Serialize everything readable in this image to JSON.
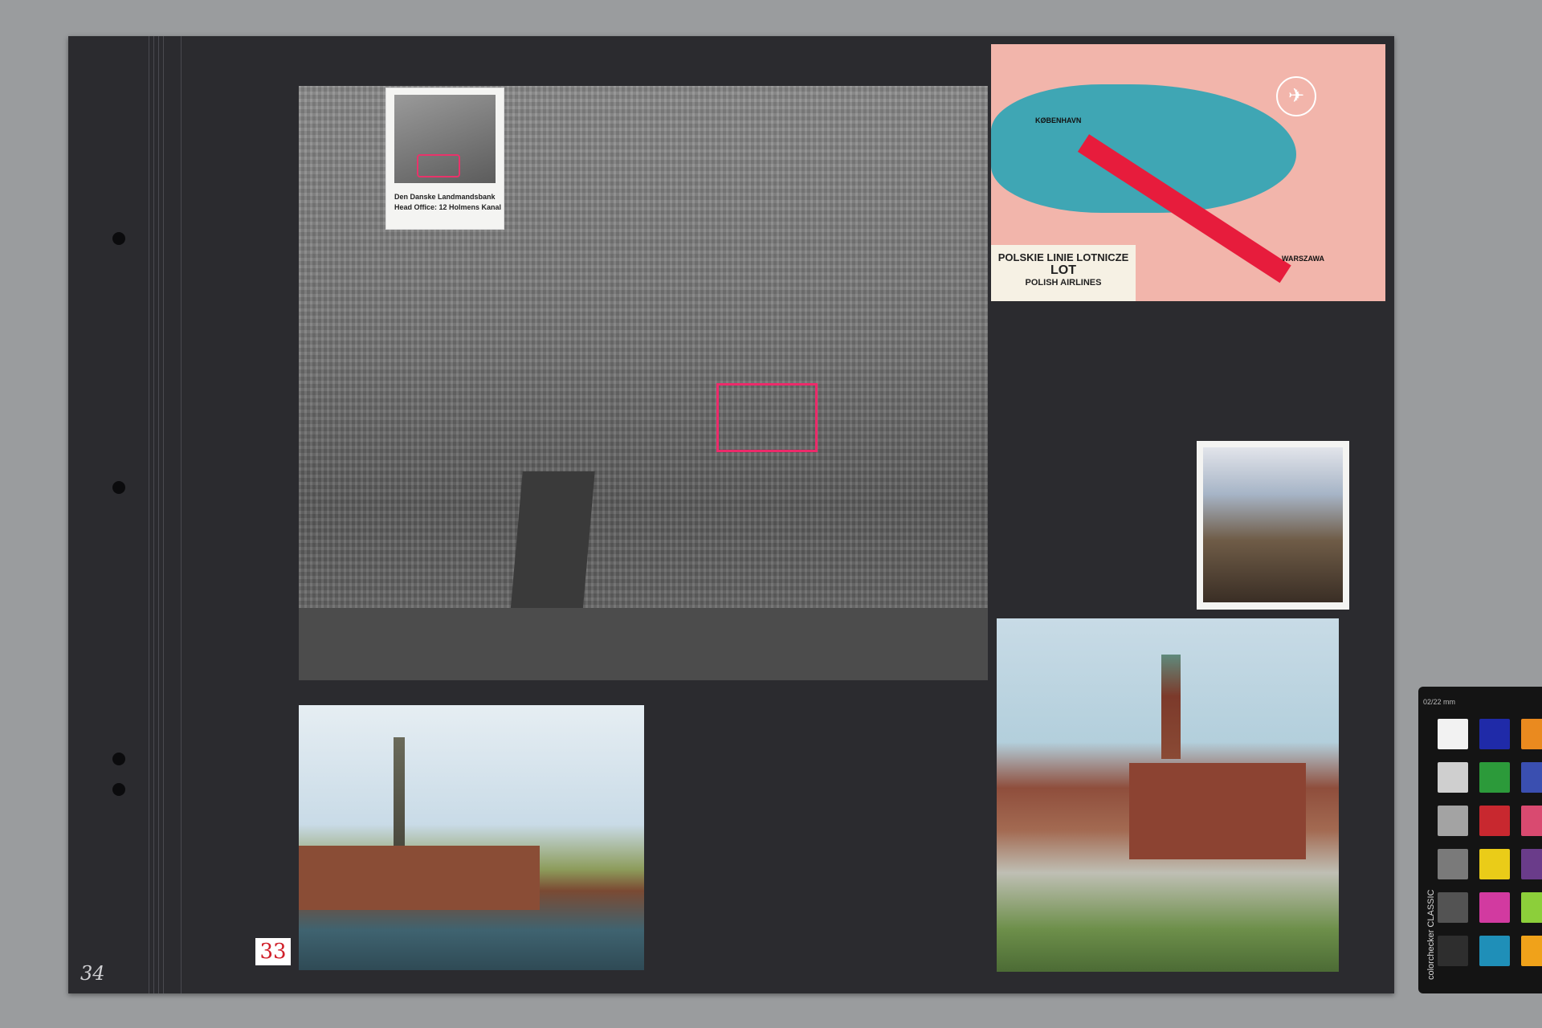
{
  "album_page": {
    "page_number": "34"
  },
  "aerial_photo": {
    "inset_caption_line1": "Den Danske Landmandsbank",
    "inset_caption_line2": "Head Office: 12 Holmens Kanal"
  },
  "airline_card": {
    "title": "POLSKIE LINIE LOTNICZE",
    "brand": "LOT",
    "subtitle": "POLISH AIRLINES",
    "origin": "KØBENHAVN",
    "destination": "WARSZAWA"
  },
  "borsen_photo": {
    "sticker_number": "33"
  },
  "color_checker": {
    "label": "colorchecker CLASSIC",
    "scale_label": "02/22 mm",
    "patches": [
      "#f2f2f2",
      "#1f2aa8",
      "#ea8a1f",
      "#cfcfcf",
      "#2c9a3a",
      "#3a4fb0",
      "#a3a3a3",
      "#c8282f",
      "#d94a70",
      "#7a7a7a",
      "#eacc18",
      "#6a3c8a",
      "#535353",
      "#d23aa0",
      "#8ccf3a",
      "#2e2e2e",
      "#1f8fb8",
      "#f0a21a"
    ]
  }
}
